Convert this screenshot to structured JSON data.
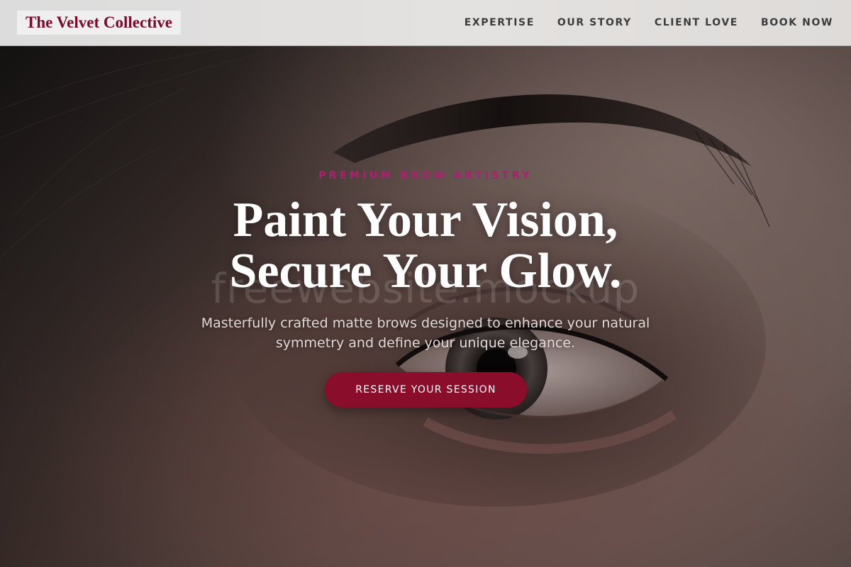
{
  "header": {
    "logo": "The Velvet Collective",
    "nav": [
      {
        "label": "EXPERTISE"
      },
      {
        "label": "OUR STORY"
      },
      {
        "label": "CLIENT LOVE"
      },
      {
        "label": "BOOK NOW"
      }
    ]
  },
  "hero": {
    "eyebrow": "PREMIUM BROW ARTISTRY",
    "headline_line1": "Paint Your Vision,",
    "headline_line2": "Secure Your Glow.",
    "subtext": "Masterfully crafted matte brows designed to enhance your natural symmetry and define your unique elegance.",
    "cta_label": "RESERVE YOUR SESSION",
    "watermark": "freewebsite.mockup"
  },
  "colors": {
    "brand": "#7c0a2e",
    "cta": "#8a0d2c",
    "eyebrow": "#b01f6f",
    "header_bg": "#e1e0df"
  }
}
